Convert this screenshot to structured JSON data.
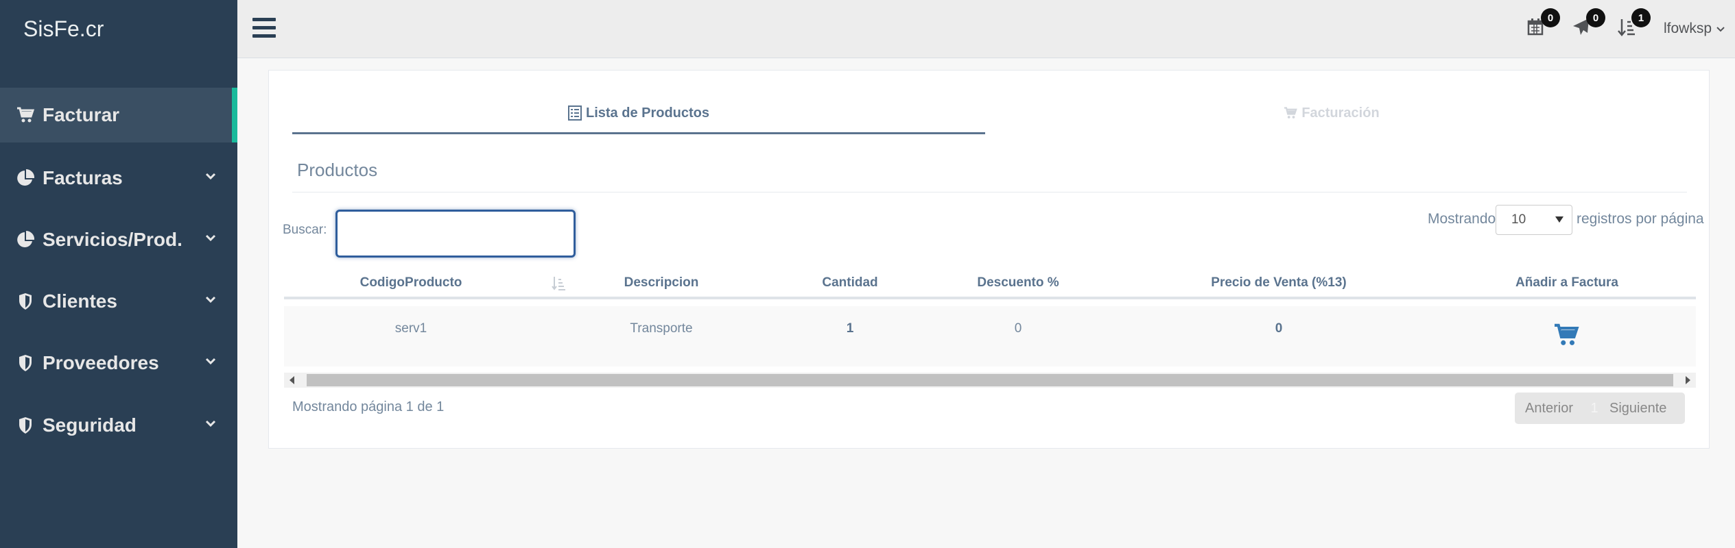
{
  "app": {
    "brand": "SisFe.cr"
  },
  "sidebar": {
    "items": [
      {
        "label": "Facturar",
        "icon": "cart-icon"
      },
      {
        "label": "Facturas",
        "icon": "pie-chart-icon"
      },
      {
        "label": "Servicios/Prod.",
        "icon": "pie-chart-icon"
      },
      {
        "label": "Clientes",
        "icon": "shield-icon"
      },
      {
        "label": "Proveedores",
        "icon": "shield-icon"
      },
      {
        "label": "Seguridad",
        "icon": "shield-icon"
      }
    ]
  },
  "topbar": {
    "notifications": [
      {
        "icon": "calendar-icon",
        "count": "0"
      },
      {
        "icon": "send-icon",
        "count": "0"
      },
      {
        "icon": "sort-icon",
        "count": "1"
      }
    ],
    "user": "lfowksp"
  },
  "wizard": {
    "steps": [
      {
        "label": "Lista de Productos",
        "icon": "list-icon"
      },
      {
        "label": "Facturación",
        "icon": "cart-icon"
      }
    ]
  },
  "section": {
    "title": "Productos"
  },
  "search": {
    "label": "Buscar:",
    "value": ""
  },
  "length": {
    "prefix": "Mostrando",
    "value": "10",
    "suffix": "registros por página"
  },
  "table": {
    "headers": [
      "CodigoProducto",
      "Descripcion",
      "Cantidad",
      "Descuento %",
      "Precio de Venta (%13)",
      "Añadir a Factura"
    ],
    "rows": [
      {
        "codigo": "serv1",
        "descripcion": "Transporte",
        "cantidad": "1",
        "descuento": "0",
        "precio": "0"
      }
    ]
  },
  "footer": {
    "info": "Mostrando página 1 de 1",
    "prev": "Anterior",
    "page": "1",
    "next": "Siguiente"
  },
  "colors": {
    "sidebar": "#2a3f54",
    "accent": "#1abb9c",
    "text": "#5a738e",
    "cart_blue": "#337ab7"
  }
}
